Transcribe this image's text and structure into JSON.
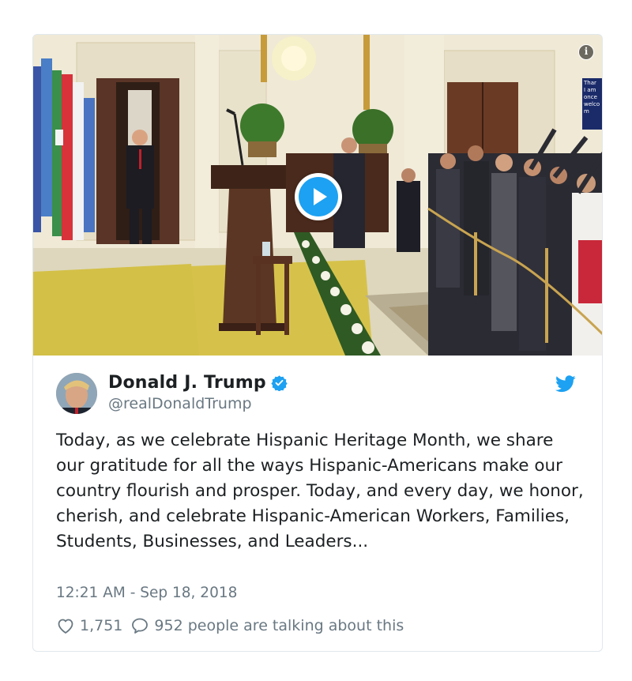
{
  "media": {
    "info_label": "i",
    "screen_text": [
      "Thar",
      "I am",
      "once",
      "welco",
      "m"
    ]
  },
  "author": {
    "name": "Donald J. Trump",
    "handle": "@realDonaldTrump"
  },
  "tweet": {
    "text": "Today, as we celebrate Hispanic Heritage Month, we share our gratitude for all the ways Hispanic-Americans make our country flourish and prosper. Today, and every day, we honor, cherish, and celebrate Hispanic-American Workers, Families, Students, Businesses, and Leaders...",
    "timestamp": "12:21 AM - Sep 18, 2018"
  },
  "actions": {
    "likes": "1,751",
    "talking": "952 people are talking about this"
  },
  "icons": {
    "verified": "verified-badge-icon",
    "bird": "twitter-bird-icon",
    "like": "heart-icon",
    "reply": "speech-bubble-icon",
    "play": "play-icon",
    "info": "info-icon"
  },
  "colors": {
    "accent": "#1da1f2",
    "text": "#1c2022",
    "muted": "#697882",
    "border": "#e1e8ed"
  }
}
